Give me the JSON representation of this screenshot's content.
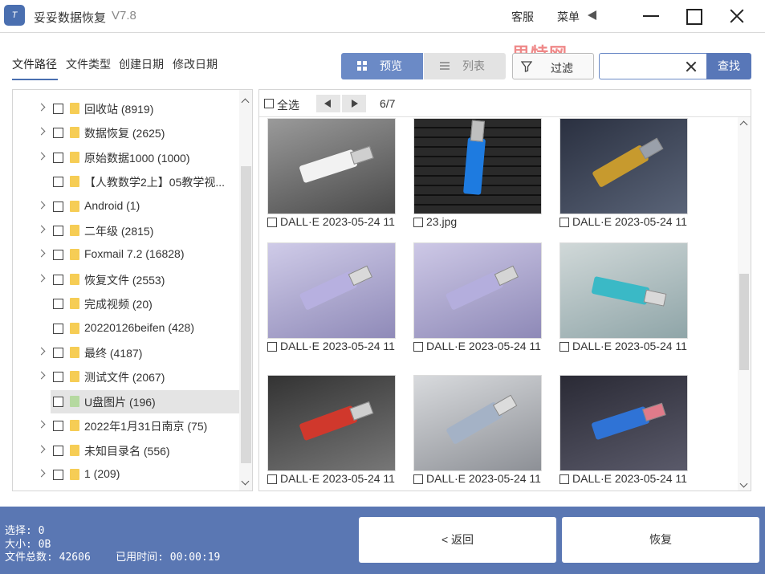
{
  "app": {
    "title": "妥妥数据恢复",
    "version": "V7.8",
    "logo_text": "T",
    "watermark": "思特网"
  },
  "titlebar": {
    "customer_service": "客服",
    "menu": "菜单"
  },
  "tabs": [
    "文件路径",
    "文件类型",
    "创建日期",
    "修改日期"
  ],
  "view": {
    "preview_label": "预览",
    "list_label": "列表"
  },
  "toolbar": {
    "filter_label": "过滤",
    "search_placeholder": "",
    "search_button": "查找"
  },
  "tree": [
    {
      "label": "回收站 (8919)",
      "expandable": true
    },
    {
      "label": "数据恢复 (2625)",
      "expandable": true
    },
    {
      "label": "原始数据1000 (1000)",
      "expandable": true
    },
    {
      "label": "【人教数学2上】05教学视...",
      "expandable": false
    },
    {
      "label": "Android (1)",
      "expandable": true
    },
    {
      "label": "二年级 (2815)",
      "expandable": true
    },
    {
      "label": "Foxmail 7.2 (16828)",
      "expandable": true
    },
    {
      "label": "恢复文件 (2553)",
      "expandable": true
    },
    {
      "label": "完成视频 (20)",
      "expandable": false
    },
    {
      "label": "20220126beifen (428)",
      "expandable": false
    },
    {
      "label": "最终 (4187)",
      "expandable": true
    },
    {
      "label": "测试文件 (2067)",
      "expandable": true
    },
    {
      "label": "U盘图片 (196)",
      "expandable": false,
      "selected": true
    },
    {
      "label": "2022年1月31日南京 (75)",
      "expandable": true
    },
    {
      "label": "未知目录名 (556)",
      "expandable": true
    },
    {
      "label": "1 (209)",
      "expandable": true
    }
  ],
  "grid": {
    "select_all": "全选",
    "page": "6/7",
    "items": [
      {
        "name": "DALL·E 2023-05-24 11",
        "theme": "gray-white"
      },
      {
        "name": "23.jpg",
        "theme": "keyboard-blue"
      },
      {
        "name": "DALL·E 2023-05-24 11",
        "theme": "dark-gold"
      },
      {
        "name": "DALL·E 2023-05-24 11",
        "theme": "lavender"
      },
      {
        "name": "DALL·E 2023-05-24 11",
        "theme": "lavender2"
      },
      {
        "name": "DALL·E 2023-05-24 11",
        "theme": "teal"
      },
      {
        "name": "DALL·E 2023-05-24 11",
        "theme": "red"
      },
      {
        "name": "DALL·E 2023-05-24 11",
        "theme": "silver"
      },
      {
        "name": "DALL·E 2023-05-24 11",
        "theme": "pink-blue"
      }
    ]
  },
  "status": {
    "selected": "选择: 0",
    "size": "大小: 0B",
    "total_and_time": "文件总数: 42606    已用时间: 00:00:19"
  },
  "buttons": {
    "back": "< 返回",
    "recover": "恢复"
  },
  "colors": {
    "accent": "#5a77b3",
    "preview_active": "#6b8ac6",
    "folder": "#f6cd55"
  }
}
